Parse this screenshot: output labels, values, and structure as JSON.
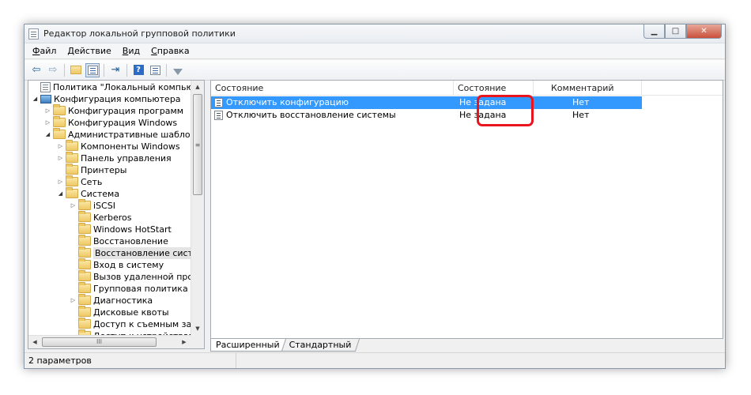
{
  "window": {
    "title": "Редактор локальной групповой политики",
    "controls": {
      "minimize": "▁",
      "maximize": "□",
      "close": "✕"
    }
  },
  "menu": {
    "items": [
      {
        "ul": "Ф",
        "rest": "айл"
      },
      {
        "ul": "Д",
        "rest": "ействие"
      },
      {
        "ul": "В",
        "rest": "ид"
      },
      {
        "ul": "С",
        "rest": "правка"
      }
    ]
  },
  "toolbar": {
    "icons": [
      "back-arrow-icon",
      "forward-arrow-icon",
      "up-folder-icon",
      "show-tree-icon",
      "export-list-icon",
      "help-icon",
      "properties-icon",
      "filter-icon"
    ],
    "back_glyph": "⇦",
    "forward_glyph": "⇨",
    "export_glyph": "⇥"
  },
  "tree": {
    "items": [
      {
        "label": "Политика \"Локальный компьютер\"",
        "icon": "policy",
        "level": 0,
        "arrow": ""
      },
      {
        "label": "Конфигурация компьютера",
        "icon": "computer",
        "level": 0,
        "arrow": "◢"
      },
      {
        "label": "Конфигурация программ",
        "icon": "folder",
        "level": 1,
        "arrow": "▷"
      },
      {
        "label": "Конфигурация Windows",
        "icon": "folder",
        "level": 1,
        "arrow": "▷"
      },
      {
        "label": "Административные шаблоны",
        "icon": "folder",
        "level": 1,
        "arrow": "◢"
      },
      {
        "label": "Компоненты Windows",
        "icon": "folder",
        "level": 2,
        "arrow": "▷"
      },
      {
        "label": "Панель управления",
        "icon": "folder",
        "level": 2,
        "arrow": "▷"
      },
      {
        "label": "Принтеры",
        "icon": "folder",
        "level": 2,
        "arrow": ""
      },
      {
        "label": "Сеть",
        "icon": "folder",
        "level": 2,
        "arrow": "▷"
      },
      {
        "label": "Система",
        "icon": "folder",
        "level": 2,
        "arrow": "◢"
      },
      {
        "label": "iSCSI",
        "icon": "folder",
        "level": 3,
        "arrow": "▷"
      },
      {
        "label": "Kerberos",
        "icon": "folder",
        "level": 3,
        "arrow": ""
      },
      {
        "label": "Windows HotStart",
        "icon": "folder",
        "level": 3,
        "arrow": ""
      },
      {
        "label": "Восстановление",
        "icon": "folder",
        "level": 3,
        "arrow": ""
      },
      {
        "label": "Восстановление системы",
        "icon": "folder",
        "level": 3,
        "arrow": "",
        "selected": true
      },
      {
        "label": "Вход в систему",
        "icon": "folder",
        "level": 3,
        "arrow": ""
      },
      {
        "label": "Вызов удаленной процеду",
        "icon": "folder",
        "level": 3,
        "arrow": ""
      },
      {
        "label": "Групповая политика",
        "icon": "folder",
        "level": 3,
        "arrow": ""
      },
      {
        "label": "Диагностика",
        "icon": "folder",
        "level": 3,
        "arrow": "▷"
      },
      {
        "label": "Дисковые квоты",
        "icon": "folder",
        "level": 3,
        "arrow": ""
      },
      {
        "label": "Доступ к съемным запом",
        "icon": "folder",
        "level": 3,
        "arrow": ""
      },
      {
        "label": "Доступ к устройствам Enh",
        "icon": "folder",
        "level": 3,
        "arrow": ""
      }
    ],
    "scrollbar": {
      "up": "▲",
      "down": "▼",
      "left": "◀",
      "right": "▶",
      "vgrip": "≡",
      "hgrip": "III"
    }
  },
  "list": {
    "columns": [
      "Состояние",
      "Состояние",
      "Комментарий"
    ],
    "rows": [
      {
        "name": "Отключить конфигурацию",
        "state": "Не задана",
        "comment": "Нет",
        "selected": true
      },
      {
        "name": "Отключить восстановление системы",
        "state": "Не задана",
        "comment": "Нет",
        "selected": false
      }
    ]
  },
  "tabs": [
    "Расширенный",
    "Стандартный"
  ],
  "status": {
    "text": "2 параметров"
  },
  "colors": {
    "selection": "#3399ff",
    "highlight_ring": "#e8141e"
  }
}
